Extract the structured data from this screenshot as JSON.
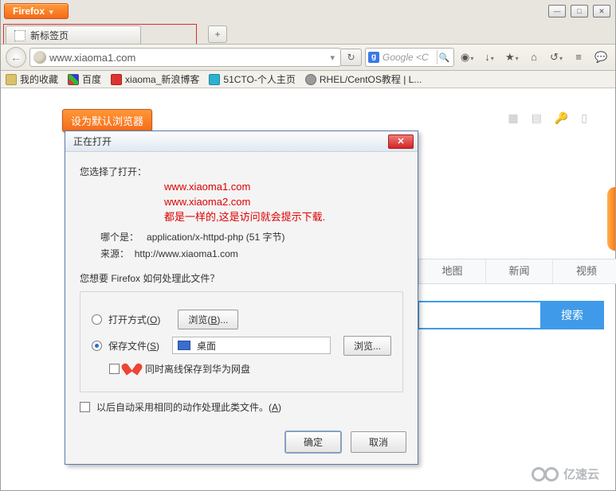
{
  "window": {
    "app_button": "Firefox",
    "min": "—",
    "max": "□",
    "close": "✕"
  },
  "tabs": {
    "active": {
      "title": "新标签页"
    },
    "new_tab": "+"
  },
  "nav": {
    "back": "←",
    "url": "www.xiaoma1.com",
    "dropdown": "▾",
    "refresh": "↻",
    "search": {
      "engine": "g",
      "placeholder": "Google <C",
      "go": "🔍"
    },
    "icons": {
      "abp": "◉",
      "down": "↓",
      "star": "★",
      "home": "⌂",
      "sync": "↺",
      "menu": "≡",
      "chat": "💬"
    }
  },
  "bookmarks": {
    "b1": "我的收藏",
    "b2": "百度",
    "b3": "xiaoma_新浪博客",
    "b4": "51CTO-个人主页",
    "b5": "RHEL/CentOS教程 | L..."
  },
  "page": {
    "set_default": "设为默认浏览器",
    "tools": {
      "grid": "▦",
      "list": "▤",
      "key": "🔑",
      "phone": "▯"
    },
    "cats": {
      "c1": "地图",
      "c2": "新闻",
      "c3": "视频"
    },
    "search_btn": "搜索",
    "brand": "亿速云"
  },
  "dialog": {
    "title": "正在打开",
    "you_open": "您选择了打开：",
    "annot1": "www.xiaoma1.com",
    "annot2": "www.xiaoma2.com",
    "annot3": "都是一样的,这是访问就会提示下载.",
    "which_is": "哪个是：",
    "mime": "application/x-httpd-php (51 字节)",
    "from_lbl": "来源：",
    "from_val": "http://www.xiaoma1.com",
    "question": "您想要 Firefox 如何处理此文件？",
    "open_with": "打开方式(O)",
    "browse1": "浏览(B)...",
    "save_file": "保存文件(S)",
    "dest": "桌面",
    "browse2": "浏览...",
    "huawei": "同时离线保存到华为网盘",
    "remember": "以后自动采用相同的动作处理此类文件。(A)",
    "ok": "确定",
    "cancel": "取消"
  }
}
